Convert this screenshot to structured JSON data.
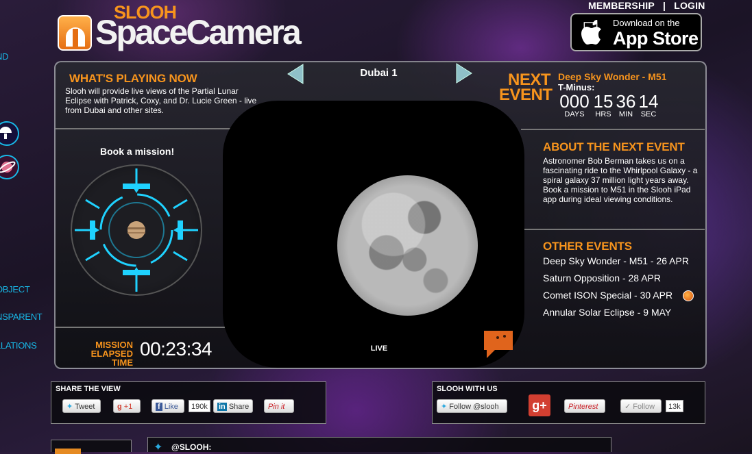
{
  "header": {
    "brand_top": "SLOOH",
    "brand_main": "SpaceCamera",
    "membership": "MEMBERSHIP",
    "separator": "|",
    "login": "LOGIN",
    "appstore_line1": "Download on the",
    "appstore_line2": "App Store"
  },
  "left_edge": {
    "item1": "ND",
    "item2": "OBJECT",
    "item3": "NSPARENT",
    "item4": "LLATIONS"
  },
  "now_playing": {
    "heading": "WHAT'S PLAYING NOW",
    "body": "Slooh will provide live views of the Partial Lunar Eclipse with Patrick, Coxy, and Dr. Lucie Green - live from Dubai and other sites."
  },
  "camera": {
    "name": "Dubai 1",
    "live_label": "LIVE"
  },
  "mission": {
    "book_label": "Book a mission!",
    "elapsed_line1": "MISSION",
    "elapsed_line2": "ELAPSED TIME",
    "elapsed_value": "00:23:34"
  },
  "next_event": {
    "label_line1": "NEXT",
    "label_line2": "EVENT",
    "title": "Deep Sky Wonder - M51",
    "tminus_label": "T-Minus:",
    "days": "000",
    "hrs": "15",
    "min": "36",
    "sec": "14",
    "days_label": "DAYS",
    "hrs_label": "HRS",
    "min_label": "MIN",
    "sec_label": "SEC"
  },
  "about": {
    "heading": "ABOUT THE NEXT EVENT",
    "body": "Astronomer Bob Berman takes us on a fascinating ride to the Whirlpool Galaxy - a spiral galaxy 37 million light years away. Book a mission to M51 in the Slooh iPad app during ideal viewing conditions."
  },
  "other_events": {
    "heading": "OTHER EVENTS",
    "items": [
      "Deep Sky Wonder - M51 - 26 APR",
      "Saturn Opposition - 28 APR",
      "Comet ISON Special - 30 APR",
      "Annular Solar Eclipse - 9 MAY"
    ]
  },
  "share": {
    "title": "SHARE THE VIEW",
    "tweet": "Tweet",
    "gplus": "+1",
    "like": "Like",
    "like_count": "190k",
    "share": "Share",
    "pinit": "Pin it"
  },
  "slooh_with_us": {
    "title": "SLOOH WITH US",
    "follow_twitter": "Follow @slooh",
    "pinterest": "Pinterest",
    "follow": "Follow",
    "follow_count": "13k"
  },
  "twitter_feed": {
    "handle": "@SLOOH:"
  },
  "colors": {
    "accent": "#f7941d",
    "cyan": "#18b7e6"
  }
}
